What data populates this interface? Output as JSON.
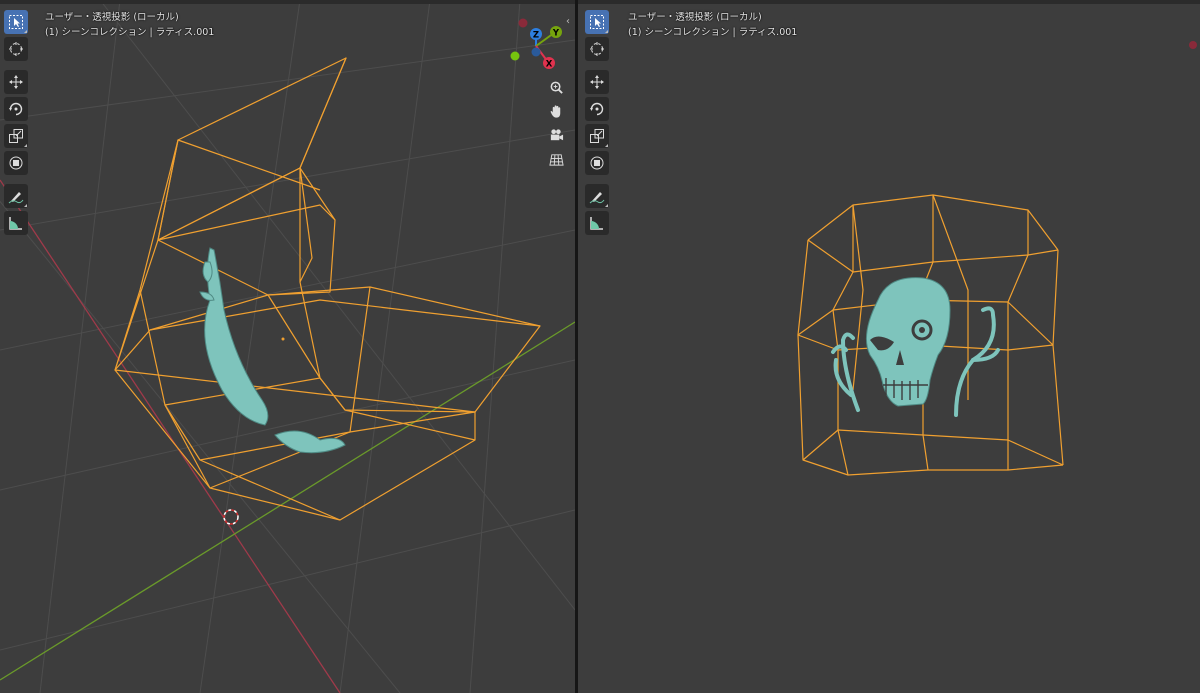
{
  "left_viewport": {
    "view_name": "ユーザー・透視投影 (ローカル)",
    "collection_info": "(1) シーンコレクション | ラティス.001"
  },
  "right_viewport": {
    "view_name": "ユーザー・透視投影 (ローカル)",
    "collection_info": "(1) シーンコレクション | ラティス.001"
  },
  "gizmo": {
    "x_label": "X",
    "y_label": "Y",
    "z_label": "Z",
    "x_color": "#e0324e",
    "y_color": "#76a40e",
    "z_color": "#2d7fe0"
  },
  "toolbar_icons": [
    "select-box-icon",
    "cursor-icon",
    "move-icon",
    "rotate-icon",
    "scale-icon",
    "transform-icon",
    "annotate-icon",
    "measure-icon"
  ],
  "navigation_icons": [
    "zoom-icon",
    "pan-hand-icon",
    "camera-icon",
    "grid-icon"
  ],
  "colors": {
    "viewport_bg": "#3d3d3d",
    "lattice": "#f0a030",
    "mesh": "#7ec4bc",
    "active_tool": "#4772b3"
  }
}
